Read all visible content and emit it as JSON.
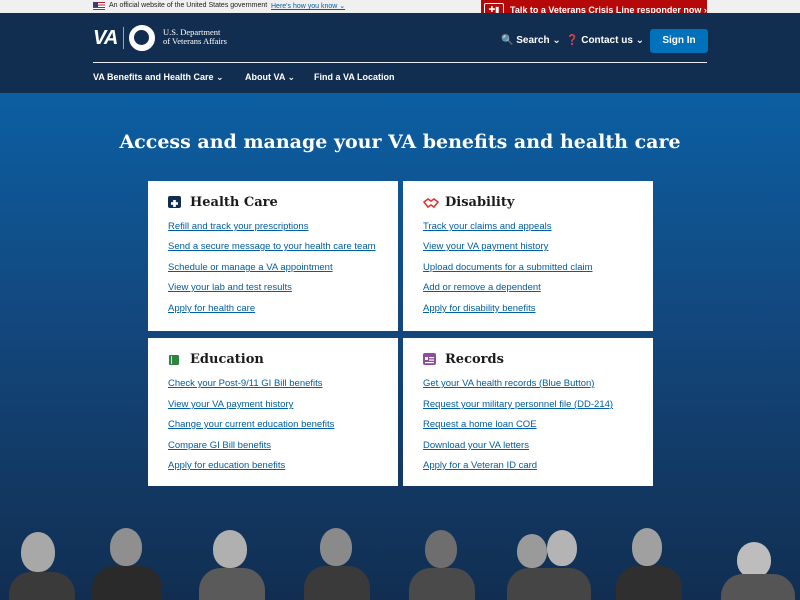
{
  "banner": {
    "official_text": "An official website of the United States government",
    "how_link": "Here's how you know ⌄"
  },
  "crisis": {
    "icon": "✚▮",
    "label": "Talk to a Veterans Crisis Line responder now ›"
  },
  "header": {
    "logo": "VA",
    "dept_line1": "U.S. Department",
    "dept_line2": "of Veterans Affairs",
    "search": "🔍 Search ⌄",
    "contact": "❓ Contact us ⌄",
    "signin": "Sign In"
  },
  "nav": [
    {
      "label": "VA Benefits and Health Care ⌄"
    },
    {
      "label": "About VA ⌄"
    },
    {
      "label": "Find a VA Location"
    }
  ],
  "hero": {
    "title": "Access and manage your VA benefits and health care"
  },
  "cards": [
    {
      "title": "Health Care",
      "icon": "medical-kit-icon",
      "color": "#112e51",
      "links": [
        "Refill and track your prescriptions",
        "Send a secure message to your health care team",
        "Schedule or manage a VA appointment",
        "View your lab and test results",
        "Apply for health care"
      ]
    },
    {
      "title": "Disability",
      "icon": "handshake-icon",
      "color": "#d83933",
      "links": [
        "Track your claims and appeals",
        "View your VA payment history",
        "Upload documents for a submitted claim",
        "Add or remove a dependent",
        "Apply for disability benefits"
      ]
    },
    {
      "title": "Education",
      "icon": "book-icon",
      "color": "#2e8540",
      "links": [
        "Check your Post-9/11 GI Bill benefits",
        "View your VA payment history",
        "Change your current education benefits",
        "Compare GI Bill benefits",
        "Apply for education benefits"
      ]
    },
    {
      "title": "Records",
      "icon": "id-card-icon",
      "color": "#8b4d9a",
      "links": [
        "Get your VA health records (Blue Button)",
        "Request your military personnel file (DD-214)",
        "Request a home loan COE",
        "Download your VA letters",
        "Apply for a Veteran ID card"
      ]
    }
  ]
}
